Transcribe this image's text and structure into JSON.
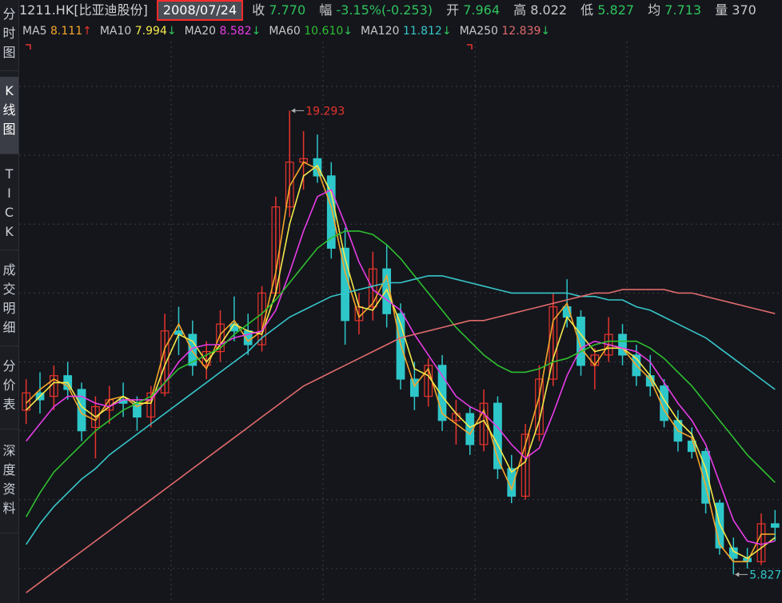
{
  "sidebar": {
    "tabs": [
      {
        "chars": [
          "分",
          "时",
          "图"
        ],
        "active": false
      },
      {
        "chars": [
          "K",
          "线",
          "图"
        ],
        "active": true
      },
      {
        "chars": [
          "T",
          "I",
          "C",
          "K"
        ],
        "active": false
      },
      {
        "chars": [
          "成",
          "交",
          "明",
          "细"
        ],
        "active": false
      },
      {
        "chars": [
          "分",
          "价",
          "表"
        ],
        "active": false
      },
      {
        "chars": [
          "深",
          "度",
          "资",
          "料"
        ],
        "active": false
      }
    ]
  },
  "header": {
    "symbol": "1211.HK[比亚迪股份]",
    "date": "2008/07/24",
    "close_label": "收",
    "close": "7.770",
    "change_label": "幅",
    "change": "-3.15%(-0.253)",
    "open_label": "开",
    "open": "7.964",
    "high_label": "高",
    "high": "8.022",
    "low_label": "低",
    "low": "5.827",
    "avg_label": "均",
    "avg": "7.713",
    "volume_label": "量",
    "volume": "370"
  },
  "ma_legend": [
    {
      "name": "MA5",
      "value": "8.111",
      "arrow": "↑",
      "color": "#f4a62a"
    },
    {
      "name": "MA10",
      "value": "7.994",
      "arrow": "↓",
      "color": "#f4e94a"
    },
    {
      "name": "MA20",
      "value": "8.582",
      "arrow": "↓",
      "color": "#e83ce6"
    },
    {
      "name": "MA60",
      "value": "10.610",
      "arrow": "↓",
      "color": "#2fbf2f"
    },
    {
      "name": "MA120",
      "value": "11.812",
      "arrow": "↓",
      "color": "#37c6c9"
    },
    {
      "name": "MA250",
      "value": "12.839",
      "arrow": "↓",
      "color": "#e06a6a"
    }
  ],
  "colors": {
    "up": "#e8342c",
    "down": "#2ec7c9",
    "grid": "#3a3d44",
    "text": "#c8c8c8",
    "background": "#14161c"
  },
  "chart_data": {
    "type": "candlestick",
    "ylim": [
      5.0,
      21.3
    ],
    "annotations": [
      {
        "label": "19.293",
        "price": 19.293,
        "kind": "high",
        "color": "#e8342c"
      },
      {
        "label": "5.827",
        "price": 5.827,
        "kind": "low",
        "color": "#2ec7c9"
      }
    ],
    "series": [
      {
        "name": "MA5",
        "color": "#f4a62a",
        "values": [
          10.8,
          11.2,
          11.5,
          11.3,
          10.5,
          10.3,
          10.9,
          11.0,
          10.7,
          10.9,
          12.4,
          13.1,
          12.3,
          11.8,
          12.8,
          13.2,
          12.6,
          12.9,
          14.6,
          17.1,
          17.8,
          17.6,
          16.5,
          14.6,
          13.3,
          13.7,
          14.5,
          12.5,
          11.3,
          11.8,
          10.5,
          10.2,
          9.9,
          10.6,
          9.2,
          8.3,
          9.6,
          11.0,
          13.2,
          13.7,
          12.4,
          11.9,
          12.5,
          12.4,
          11.9,
          11.5,
          10.6,
          10.0,
          9.8,
          8.4,
          6.7,
          6.2,
          6.2,
          7.0,
          7.0
        ]
      },
      {
        "name": "MA10",
        "color": "#f4e94a",
        "values": [
          10.6,
          11.0,
          11.4,
          11.4,
          10.7,
          10.4,
          10.7,
          11.0,
          10.8,
          10.8,
          11.9,
          12.8,
          12.6,
          12.0,
          12.5,
          13.1,
          12.9,
          12.8,
          14.0,
          16.0,
          17.4,
          17.7,
          16.9,
          15.0,
          13.6,
          13.5,
          14.1,
          13.1,
          11.8,
          11.6,
          11.0,
          10.5,
          10.1,
          10.3,
          9.6,
          8.8,
          9.1,
          10.3,
          12.1,
          13.3,
          12.8,
          12.3,
          12.4,
          12.4,
          12.1,
          11.6,
          10.9,
          10.3,
          9.9,
          8.9,
          7.3,
          6.5,
          6.3,
          6.6,
          6.9
        ]
      },
      {
        "name": "MA20",
        "color": "#e83ce6",
        "values": [
          9.7,
          10.2,
          10.7,
          11.0,
          11.0,
          10.8,
          10.7,
          10.9,
          10.9,
          10.9,
          11.4,
          12.0,
          12.4,
          12.5,
          12.5,
          12.7,
          12.8,
          12.9,
          13.5,
          14.6,
          15.8,
          16.8,
          17.0,
          16.0,
          14.9,
          14.1,
          13.8,
          13.5,
          12.8,
          12.2,
          11.6,
          11.0,
          10.7,
          10.5,
          10.1,
          9.6,
          9.2,
          9.5,
          10.5,
          11.6,
          12.4,
          12.6,
          12.5,
          12.4,
          12.3,
          12.0,
          11.4,
          10.8,
          10.3,
          9.6,
          8.5,
          7.4,
          6.8,
          6.7,
          6.8
        ]
      },
      {
        "name": "MA60",
        "color": "#2fbf2f",
        "values": [
          7.5,
          8.2,
          8.8,
          9.2,
          9.6,
          10.0,
          10.3,
          10.6,
          10.8,
          11.0,
          11.4,
          11.8,
          12.0,
          12.2,
          12.4,
          12.8,
          13.1,
          13.4,
          13.8,
          14.3,
          14.8,
          15.3,
          15.6,
          15.8,
          15.8,
          15.7,
          15.4,
          15.0,
          14.5,
          14.0,
          13.5,
          13.0,
          12.6,
          12.2,
          11.9,
          11.7,
          11.7,
          11.8,
          12.0,
          12.1,
          12.3,
          12.5,
          12.6,
          12.6,
          12.6,
          12.4,
          12.1,
          11.7,
          11.3,
          10.8,
          10.3,
          9.8,
          9.3,
          8.9,
          8.5
        ]
      },
      {
        "name": "MA120",
        "color": "#37c6c9",
        "values": [
          6.7,
          7.3,
          7.8,
          8.2,
          8.6,
          8.9,
          9.3,
          9.6,
          9.9,
          10.2,
          10.5,
          10.8,
          11.1,
          11.4,
          11.7,
          12.0,
          12.3,
          12.7,
          13.0,
          13.3,
          13.5,
          13.7,
          13.9,
          14.0,
          14.1,
          14.2,
          14.3,
          14.3,
          14.4,
          14.5,
          14.5,
          14.4,
          14.3,
          14.2,
          14.1,
          14.0,
          14.0,
          14.0,
          14.0,
          14.0,
          13.9,
          13.9,
          13.8,
          13.8,
          13.6,
          13.5,
          13.3,
          13.1,
          12.9,
          12.7,
          12.4,
          12.1,
          11.8,
          11.5,
          11.2
        ]
      },
      {
        "name": "MA250",
        "color": "#e06a6a",
        "values": [
          5.3,
          5.6,
          5.9,
          6.2,
          6.5,
          6.8,
          7.1,
          7.4,
          7.7,
          8.0,
          8.3,
          8.6,
          8.9,
          9.2,
          9.5,
          9.8,
          10.1,
          10.4,
          10.7,
          11.0,
          11.3,
          11.5,
          11.7,
          11.9,
          12.1,
          12.3,
          12.5,
          12.7,
          12.8,
          12.9,
          13.0,
          13.1,
          13.2,
          13.2,
          13.3,
          13.4,
          13.5,
          13.6,
          13.7,
          13.8,
          13.9,
          14.0,
          14.0,
          14.1,
          14.1,
          14.1,
          14.1,
          14.0,
          14.0,
          13.9,
          13.8,
          13.7,
          13.6,
          13.5,
          13.4
        ]
      }
    ],
    "candles": [
      {
        "o": 10.6,
        "h": 11.5,
        "l": 10.2,
        "c": 11.1
      },
      {
        "o": 11.1,
        "h": 11.7,
        "l": 10.5,
        "c": 10.9
      },
      {
        "o": 11.0,
        "h": 11.9,
        "l": 10.6,
        "c": 11.6
      },
      {
        "o": 11.6,
        "h": 12.0,
        "l": 10.9,
        "c": 11.2
      },
      {
        "o": 11.2,
        "h": 11.4,
        "l": 9.7,
        "c": 10.0
      },
      {
        "o": 10.1,
        "h": 11.0,
        "l": 9.2,
        "c": 10.7
      },
      {
        "o": 10.6,
        "h": 11.3,
        "l": 10.2,
        "c": 10.9
      },
      {
        "o": 10.9,
        "h": 11.4,
        "l": 10.4,
        "c": 10.8
      },
      {
        "o": 10.8,
        "h": 11.0,
        "l": 10.0,
        "c": 10.4
      },
      {
        "o": 10.4,
        "h": 11.3,
        "l": 10.1,
        "c": 11.1
      },
      {
        "o": 11.1,
        "h": 13.4,
        "l": 11.0,
        "c": 12.9
      },
      {
        "o": 12.9,
        "h": 13.6,
        "l": 12.2,
        "c": 12.8
      },
      {
        "o": 12.8,
        "h": 13.2,
        "l": 11.6,
        "c": 11.9
      },
      {
        "o": 11.9,
        "h": 12.6,
        "l": 11.5,
        "c": 12.3
      },
      {
        "o": 12.3,
        "h": 13.5,
        "l": 12.0,
        "c": 13.1
      },
      {
        "o": 13.1,
        "h": 13.9,
        "l": 12.6,
        "c": 12.9
      },
      {
        "o": 12.9,
        "h": 13.4,
        "l": 12.2,
        "c": 12.5
      },
      {
        "o": 12.5,
        "h": 14.2,
        "l": 12.3,
        "c": 14.0
      },
      {
        "o": 14.0,
        "h": 16.8,
        "l": 13.9,
        "c": 16.5
      },
      {
        "o": 16.5,
        "h": 19.293,
        "l": 16.2,
        "c": 17.8
      },
      {
        "o": 17.8,
        "h": 18.7,
        "l": 17.0,
        "c": 17.9
      },
      {
        "o": 17.9,
        "h": 18.6,
        "l": 17.2,
        "c": 17.4
      },
      {
        "o": 17.4,
        "h": 17.8,
        "l": 15.0,
        "c": 15.3
      },
      {
        "o": 15.3,
        "h": 15.9,
        "l": 12.5,
        "c": 13.2
      },
      {
        "o": 13.2,
        "h": 14.0,
        "l": 12.8,
        "c": 13.6
      },
      {
        "o": 13.6,
        "h": 15.2,
        "l": 13.2,
        "c": 14.7
      },
      {
        "o": 14.7,
        "h": 15.4,
        "l": 13.0,
        "c": 13.4
      },
      {
        "o": 13.4,
        "h": 13.7,
        "l": 11.2,
        "c": 11.5
      },
      {
        "o": 11.5,
        "h": 12.0,
        "l": 10.6,
        "c": 11.0
      },
      {
        "o": 11.0,
        "h": 12.1,
        "l": 10.7,
        "c": 11.9
      },
      {
        "o": 11.9,
        "h": 12.2,
        "l": 10.0,
        "c": 10.3
      },
      {
        "o": 10.3,
        "h": 10.9,
        "l": 9.6,
        "c": 10.5
      },
      {
        "o": 10.5,
        "h": 10.7,
        "l": 9.3,
        "c": 9.6
      },
      {
        "o": 9.6,
        "h": 11.2,
        "l": 9.4,
        "c": 10.8
      },
      {
        "o": 10.8,
        "h": 11.0,
        "l": 8.6,
        "c": 8.9
      },
      {
        "o": 8.9,
        "h": 9.3,
        "l": 7.9,
        "c": 8.1
      },
      {
        "o": 8.1,
        "h": 10.2,
        "l": 8.0,
        "c": 9.9
      },
      {
        "o": 9.9,
        "h": 11.9,
        "l": 9.7,
        "c": 11.5
      },
      {
        "o": 11.5,
        "h": 14.0,
        "l": 11.3,
        "c": 13.6
      },
      {
        "o": 13.6,
        "h": 14.4,
        "l": 13.0,
        "c": 13.3
      },
      {
        "o": 13.3,
        "h": 13.5,
        "l": 11.6,
        "c": 11.9
      },
      {
        "o": 11.9,
        "h": 12.4,
        "l": 11.2,
        "c": 12.2
      },
      {
        "o": 12.2,
        "h": 13.3,
        "l": 12.0,
        "c": 12.8
      },
      {
        "o": 12.8,
        "h": 13.1,
        "l": 11.9,
        "c": 12.2
      },
      {
        "o": 12.2,
        "h": 12.5,
        "l": 11.3,
        "c": 11.6
      },
      {
        "o": 11.6,
        "h": 12.2,
        "l": 11.0,
        "c": 11.3
      },
      {
        "o": 11.3,
        "h": 11.5,
        "l": 10.1,
        "c": 10.3
      },
      {
        "o": 10.3,
        "h": 10.6,
        "l": 9.4,
        "c": 9.7
      },
      {
        "o": 9.7,
        "h": 10.1,
        "l": 9.2,
        "c": 9.4
      },
      {
        "o": 9.4,
        "h": 9.5,
        "l": 7.6,
        "c": 7.9
      },
      {
        "o": 7.9,
        "h": 8.0,
        "l": 6.4,
        "c": 6.6
      },
      {
        "o": 6.6,
        "h": 6.9,
        "l": 5.827,
        "c": 6.3
      },
      {
        "o": 6.3,
        "h": 6.6,
        "l": 6.0,
        "c": 6.2
      },
      {
        "o": 6.2,
        "h": 7.6,
        "l": 6.1,
        "c": 7.3
      },
      {
        "o": 7.3,
        "h": 7.7,
        "l": 6.8,
        "c": 7.2
      }
    ]
  }
}
